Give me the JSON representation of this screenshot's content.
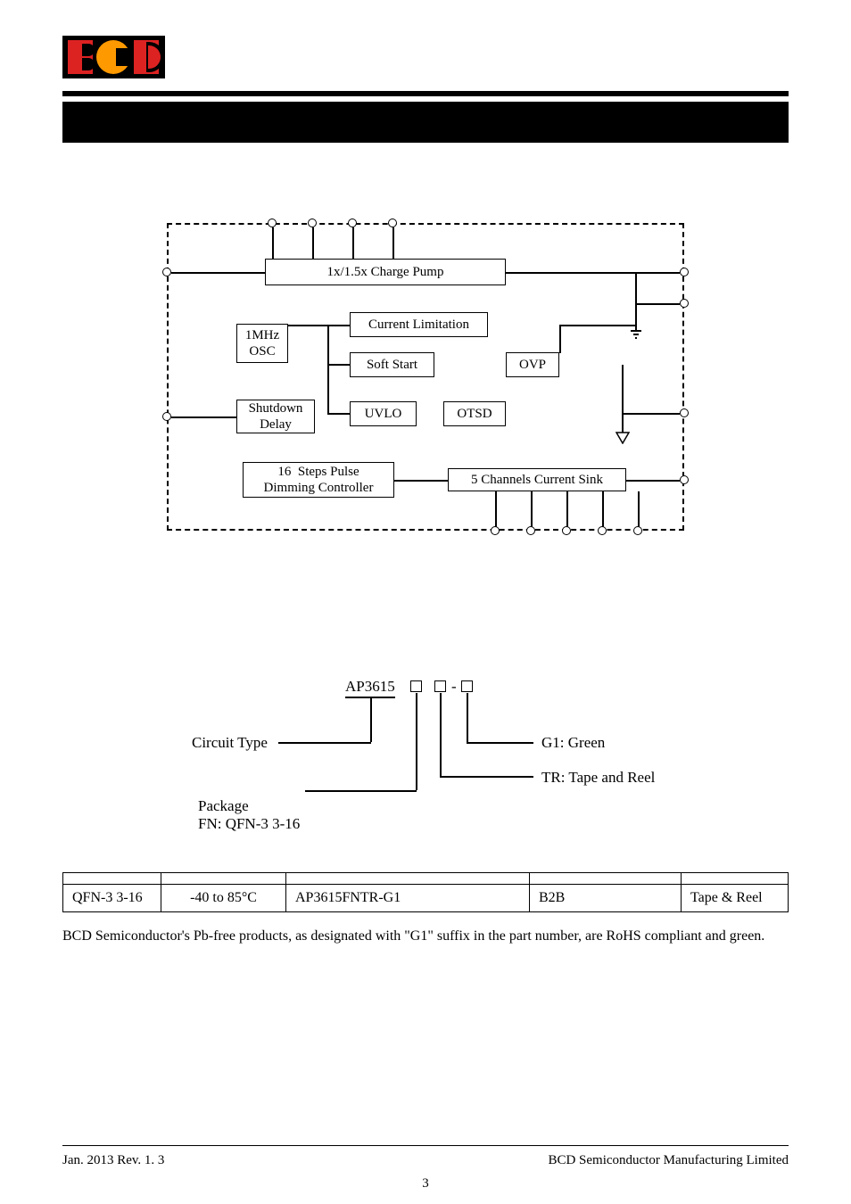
{
  "block_diagram": {
    "boxes": {
      "charge_pump": "1x/1.5x Charge Pump",
      "osc": "1MHz\nOSC",
      "current_limit": "Current Limitation",
      "soft_start": "Soft Start",
      "ovp": "OVP",
      "shutdown": "Shutdown\nDelay",
      "uvlo": "UVLO",
      "otsd": "OTSD",
      "dimming": "16  Steps Pulse\nDimming Controller",
      "current_sink": "5 Channels Current Sink"
    }
  },
  "ordering_diagram": {
    "part_prefix": "AP3615",
    "labels": {
      "circuit_type": "Circuit Type",
      "package": "Package",
      "package_code": "FN: QFN-3  3-16",
      "g1": "G1: Green",
      "tr": "TR: Tape and Reel"
    }
  },
  "table": {
    "headers": [
      "",
      "",
      "",
      "",
      ""
    ],
    "row": {
      "package": "QFN-3  3-16",
      "temp": "-40 to 85°C",
      "partnum": "AP3615FNTR-G1",
      "marking": "B2B",
      "shipping": "Tape & Reel"
    }
  },
  "note": "BCD Semiconductor's Pb-free products, as designated with \"G1\" suffix in the part number, are RoHS compliant and green.",
  "footer": {
    "left": "Jan. 2013    Rev. 1. 3",
    "right": "BCD Semiconductor Manufacturing Limited",
    "page": "3"
  }
}
